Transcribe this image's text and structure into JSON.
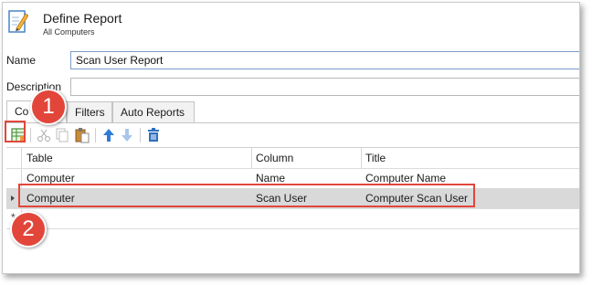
{
  "window": {
    "title": "Define Report",
    "subtitle": "All Computers",
    "icon": "report-pencil-icon"
  },
  "form": {
    "name_label": "Name",
    "name_value": "Scan User Report",
    "description_label": "Description",
    "description_value": ""
  },
  "tabs": [
    {
      "label": "Co",
      "active": true
    },
    {
      "label": "Filters",
      "active": false
    },
    {
      "label": "Auto Reports",
      "active": false
    }
  ],
  "toolbar": {
    "icons": [
      "add-column-icon",
      "cut-icon",
      "copy-icon",
      "paste-icon",
      "move-up-icon",
      "move-down-icon",
      "delete-icon"
    ]
  },
  "grid": {
    "columns": [
      "Table",
      "Column",
      "Title"
    ],
    "rows": [
      {
        "table": "Computer",
        "column": "Name",
        "title": "Computer Name",
        "selected": false
      },
      {
        "table": "Computer",
        "column": "Scan User",
        "title": "Computer Scan User",
        "selected": true
      }
    ],
    "new_row_marker": "*"
  },
  "callouts": [
    "1",
    "2"
  ],
  "colors": {
    "callout": "#e2463b",
    "selected_row": "#d9d9d9",
    "accent_blue": "#2f7bd6"
  }
}
